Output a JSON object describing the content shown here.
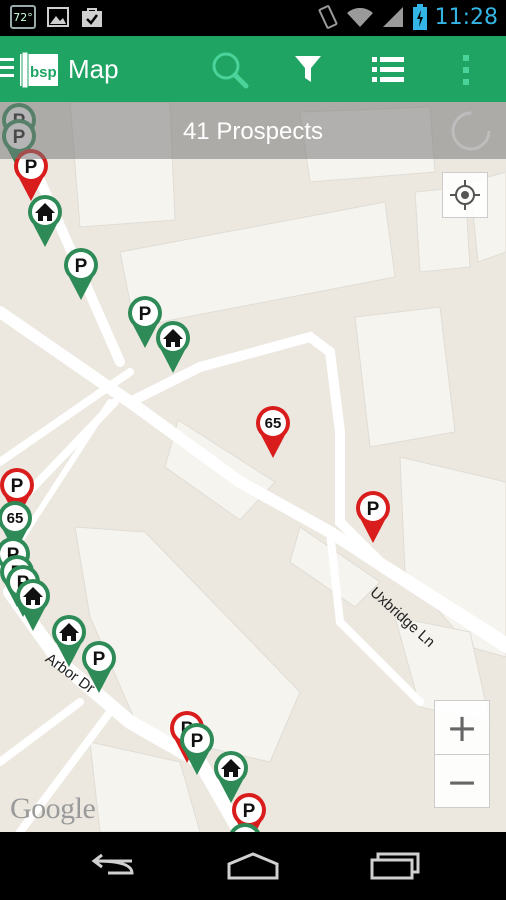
{
  "status_bar": {
    "temperature_badge": "72°",
    "notification_icons": [
      "gallery-icon",
      "bag-check-icon"
    ],
    "system_icons": [
      "vibrate-icon",
      "wifi-icon",
      "signal-icon",
      "battery-charging-icon"
    ],
    "time": "11:28"
  },
  "app_bar": {
    "title": "Map",
    "logo_text": "bsp",
    "actions": [
      "search-icon",
      "filter-icon",
      "list-icon",
      "overflow-menu-icon"
    ],
    "color": "#1fa463"
  },
  "map": {
    "banner_text": "41 Prospects",
    "streets": [
      "Uxbridge Ln",
      "Arbor Dr"
    ],
    "zoom_in_label": "+",
    "zoom_out_label": "−",
    "attribution": "Google",
    "pin_colors": {
      "green": "#2e8b57",
      "red": "#d91c1c"
    },
    "pins": [
      {
        "color": "green",
        "label": "P"
      },
      {
        "color": "green",
        "label": "P"
      },
      {
        "color": "red",
        "label": "P"
      },
      {
        "color": "green",
        "label": "house"
      },
      {
        "color": "green",
        "label": "P"
      },
      {
        "color": "green",
        "label": "P"
      },
      {
        "color": "green",
        "label": "house"
      },
      {
        "color": "red",
        "label": "65"
      },
      {
        "color": "red",
        "label": "P"
      },
      {
        "color": "red",
        "label": "P"
      },
      {
        "color": "green",
        "label": "65"
      },
      {
        "color": "green",
        "label": "P"
      },
      {
        "color": "green",
        "label": "P"
      },
      {
        "color": "green",
        "label": "P"
      },
      {
        "color": "green",
        "label": "house"
      },
      {
        "color": "green",
        "label": "house"
      },
      {
        "color": "green",
        "label": "P"
      },
      {
        "color": "red",
        "label": "P"
      },
      {
        "color": "green",
        "label": "P"
      },
      {
        "color": "green",
        "label": "house"
      },
      {
        "color": "red",
        "label": "P"
      },
      {
        "color": "green",
        "label": "P"
      }
    ]
  },
  "nav_bar": {
    "buttons": [
      "back-icon",
      "home-icon",
      "recents-icon"
    ]
  }
}
